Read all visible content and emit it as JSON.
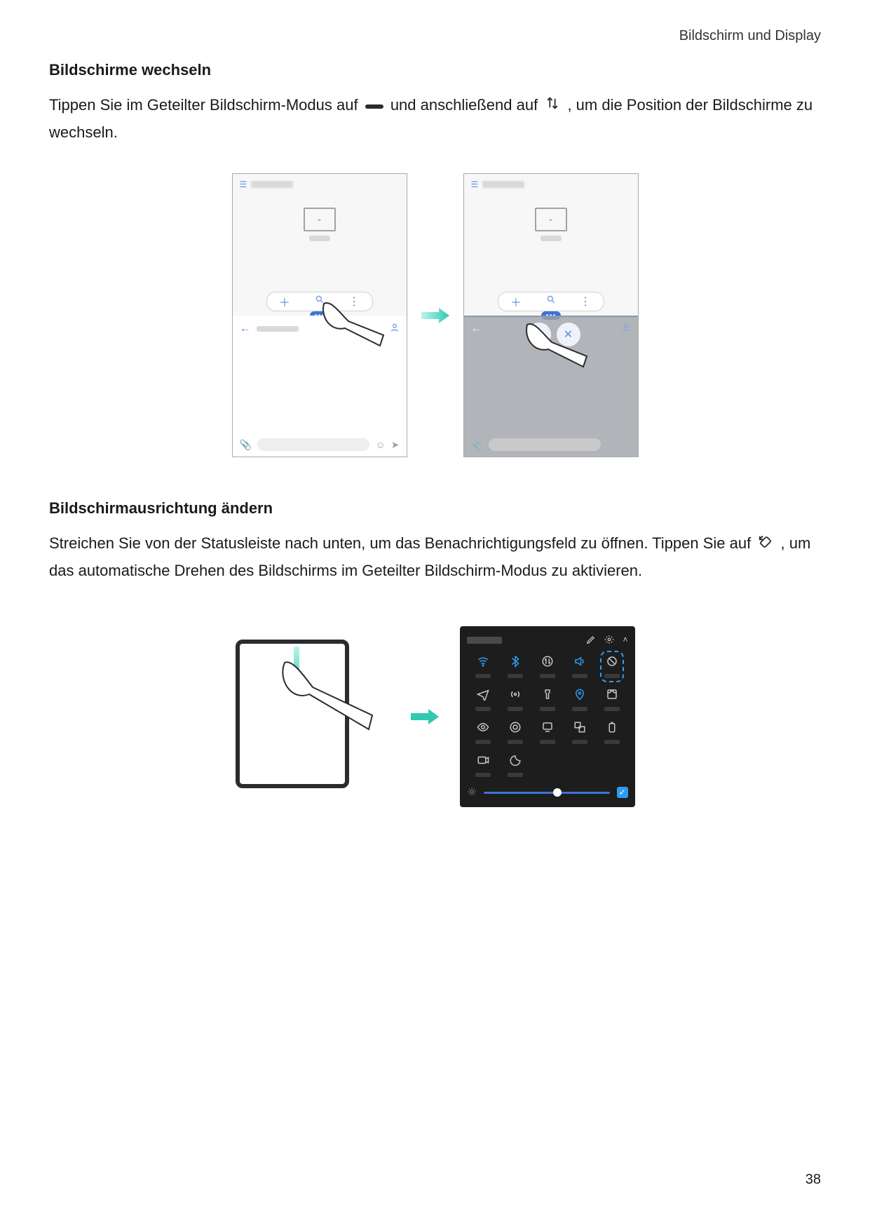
{
  "breadcrumb": "Bildschirm und Display",
  "page_number": "38",
  "section1": {
    "heading": "Bildschirme wechseln",
    "p1_a": "Tippen Sie im Geteilter Bildschirm-Modus auf ",
    "p1_b": " und anschließend auf ",
    "p1_c": ", um die Position der Bildschirme zu wechseln."
  },
  "section2": {
    "heading": "Bildschirmausrichtung ändern",
    "p1_a": "Streichen Sie von der Statusleiste nach unten, um das Benachrichtigungsfeld zu öffnen. Tippen Sie auf ",
    "p1_b": ", um das automatische Drehen des Bildschirms im Geteilter Bildschirm-Modus zu aktivieren."
  },
  "icons": {
    "handle": "split-handle-icon",
    "swap": "swap-icon",
    "rotate_lock": "auto-rotate-icon"
  },
  "qs_panel": {
    "tiles": [
      {
        "name": "wifi-icon",
        "active": true
      },
      {
        "name": "bluetooth-icon",
        "active": true
      },
      {
        "name": "swap-toggle-icon",
        "active": false
      },
      {
        "name": "sound-icon",
        "active": true
      },
      {
        "name": "auto-rotate-icon",
        "active": false,
        "highlight": true
      },
      {
        "name": "airplane-icon",
        "active": false
      },
      {
        "name": "hotspot-icon",
        "active": false
      },
      {
        "name": "flashlight-icon",
        "active": false
      },
      {
        "name": "location-icon",
        "active": true
      },
      {
        "name": "screenshot-icon",
        "active": false
      },
      {
        "name": "eye-comfort-icon",
        "active": false
      },
      {
        "name": "nfc-icon",
        "active": false
      },
      {
        "name": "cast-icon",
        "active": false
      },
      {
        "name": "multiwindow-icon",
        "active": false
      },
      {
        "name": "battery-icon",
        "active": false
      },
      {
        "name": "screen-record-icon",
        "active": false
      },
      {
        "name": "dnd-icon",
        "active": false
      }
    ]
  }
}
